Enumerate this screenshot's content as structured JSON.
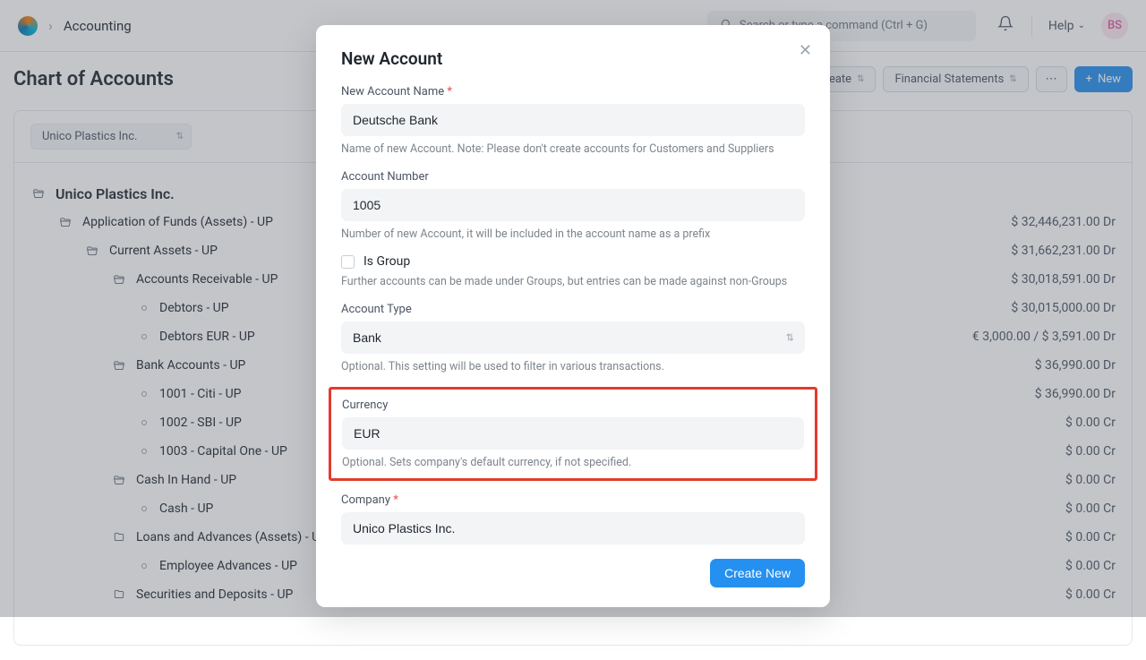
{
  "header": {
    "breadcrumb": "Accounting",
    "search_placeholder": "Search or type a command (Ctrl + G)",
    "help_label": "Help",
    "avatar": "BS"
  },
  "page": {
    "title": "Chart of Accounts",
    "create_btn": "Create",
    "fin_stmt_btn": "Financial Statements",
    "new_btn": "New",
    "company_select": "Unico Plastics Inc."
  },
  "tree": {
    "root": {
      "label": "Unico Plastics Inc."
    },
    "assets": {
      "label": "Application of Funds (Assets) - UP",
      "balance": "$ 32,446,231.00 Dr"
    },
    "current_assets": {
      "label": "Current Assets - UP",
      "balance": "$ 31,662,231.00 Dr"
    },
    "ar": {
      "label": "Accounts Receivable - UP",
      "balance": "$ 30,018,591.00 Dr"
    },
    "debtors": {
      "label": "Debtors - UP",
      "balance": "$ 30,015,000.00 Dr"
    },
    "debtors_eur": {
      "label": "Debtors EUR - UP",
      "balance": "€ 3,000.00 / $ 3,591.00 Dr"
    },
    "bank_accounts": {
      "label": "Bank Accounts - UP",
      "balance": "$ 36,990.00 Dr"
    },
    "citi": {
      "label": "1001 - Citi - UP",
      "balance": "$ 36,990.00 Dr"
    },
    "sbi": {
      "label": "1002 - SBI - UP",
      "balance": "$ 0.00 Cr"
    },
    "capone": {
      "label": "1003 - Capital One - UP",
      "balance": "$ 0.00 Cr"
    },
    "cih": {
      "label": "Cash In Hand - UP",
      "balance": "$ 0.00 Cr"
    },
    "cash": {
      "label": "Cash - UP",
      "balance": "$ 0.00 Cr"
    },
    "loans": {
      "label": "Loans and Advances (Assets) - UP",
      "balance": "$ 0.00 Cr"
    },
    "emp_adv": {
      "label": "Employee Advances - UP",
      "balance": "$ 0.00 Cr"
    },
    "securities": {
      "label": "Securities and Deposits - UP",
      "balance": "$ 0.00 Cr"
    }
  },
  "modal": {
    "title": "New Account",
    "name_label": "New Account Name",
    "name_value": "Deutsche Bank",
    "name_help": "Name of new Account. Note: Please don't create accounts for Customers and Suppliers",
    "number_label": "Account Number",
    "number_value": "1005",
    "number_help": "Number of new Account, it will be included in the account name as a prefix",
    "is_group_label": "Is Group",
    "is_group_help": "Further accounts can be made under Groups, but entries can be made against non-Groups",
    "type_label": "Account Type",
    "type_value": "Bank",
    "type_help": "Optional. This setting will be used to filter in various transactions.",
    "currency_label": "Currency",
    "currency_value": "EUR",
    "currency_help": "Optional. Sets company's default currency, if not specified.",
    "company_label": "Company",
    "company_value": "Unico Plastics Inc.",
    "create_btn": "Create New"
  }
}
